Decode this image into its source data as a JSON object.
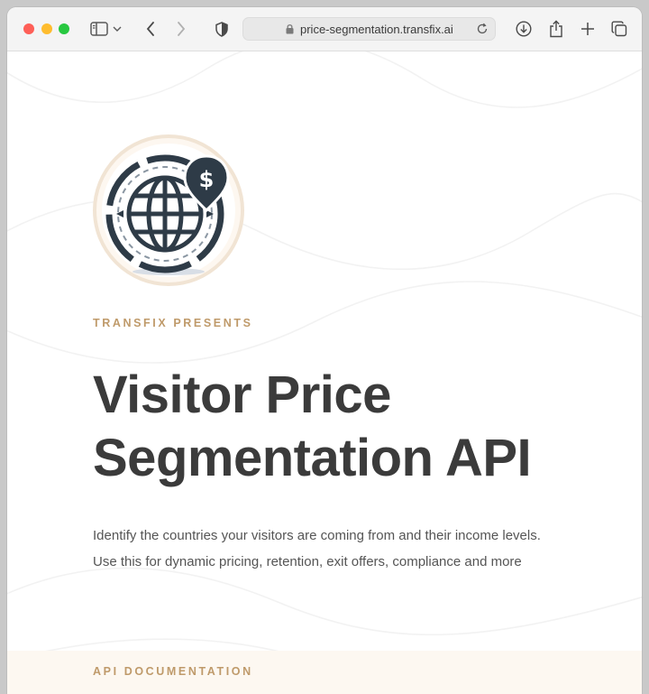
{
  "browser": {
    "url": "price-segmentation.transfix.ai"
  },
  "hero": {
    "eyebrow": "TRANSFIX PRESENTS",
    "title_line1": "Visitor Price",
    "title_line2": "Segmentation API",
    "description_line1": "Identify the countries your visitors are coming from and their income levels.",
    "description_line2": "Use this for dynamic pricing, retention, exit offers, compliance and more"
  },
  "docs": {
    "label": "API DOCUMENTATION"
  },
  "colors": {
    "accent": "#bf9a6a",
    "title": "#3b3b3b",
    "body_text": "#555555",
    "band": "#fdf8f1"
  },
  "icons": {
    "logo": "globe-with-dollar-pin-icon"
  }
}
